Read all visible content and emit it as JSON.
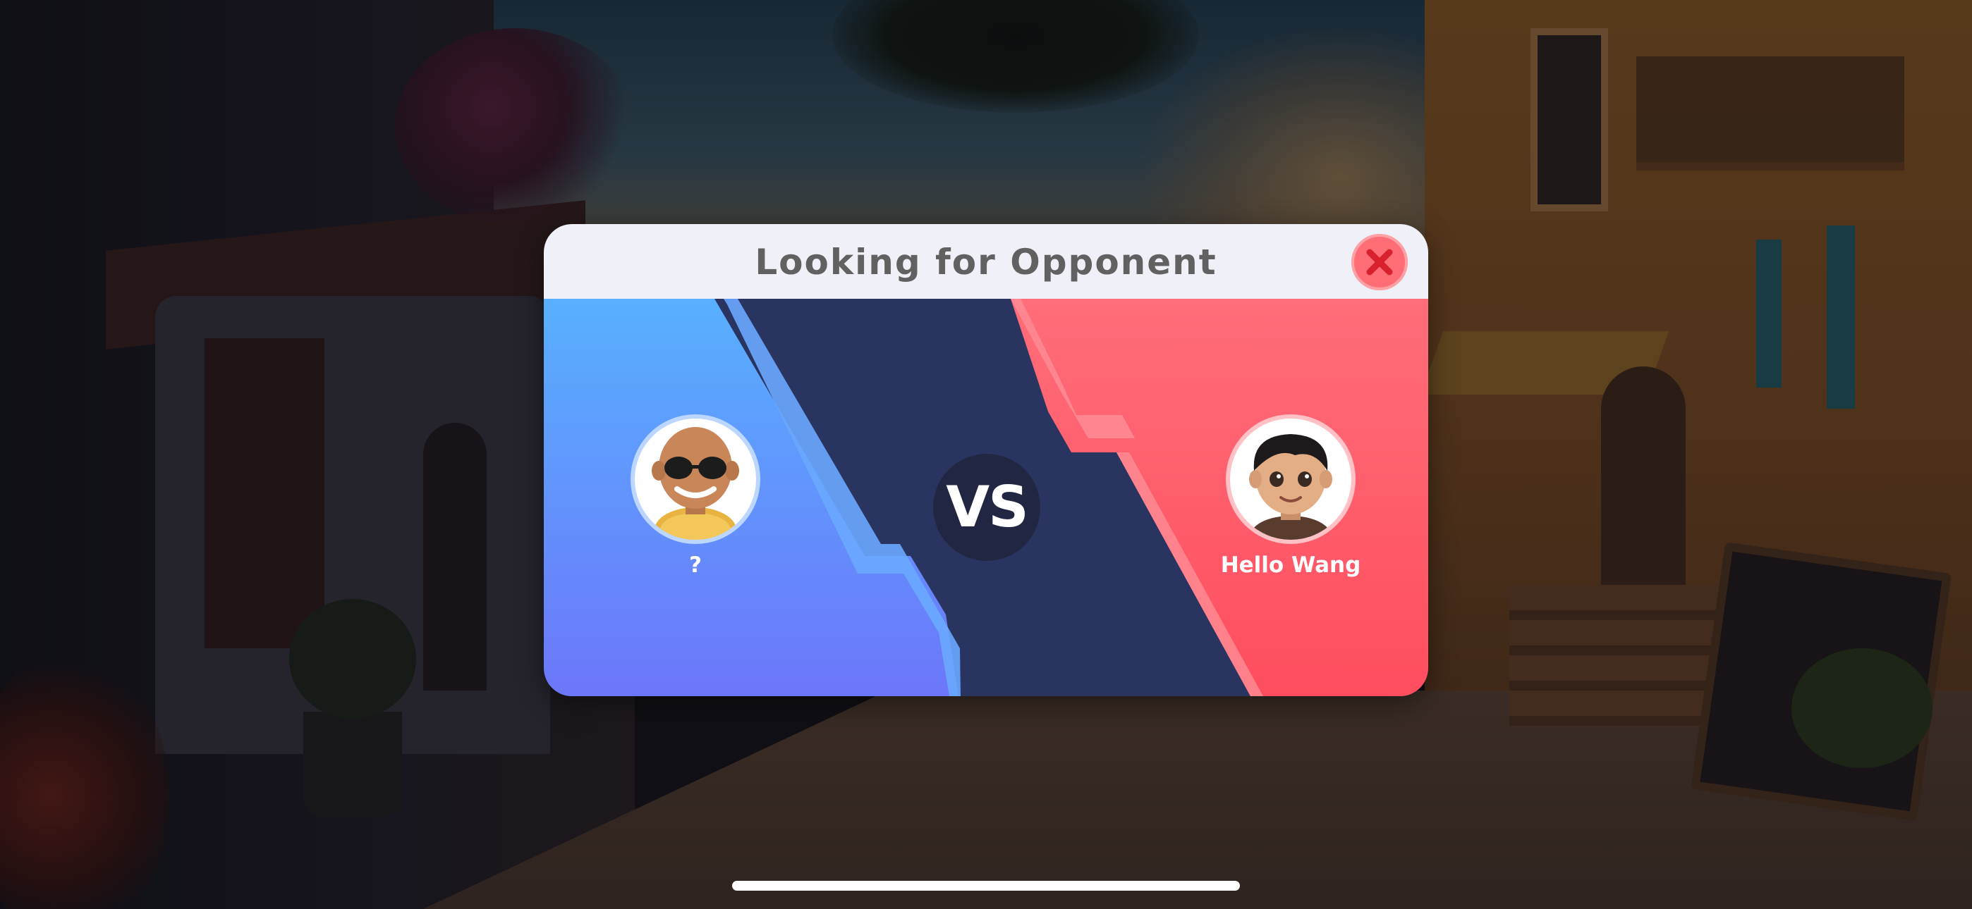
{
  "dialog": {
    "title": "Looking for Opponent",
    "close_icon": "close-icon"
  },
  "players": {
    "left": {
      "name": "?",
      "avatar": "avatar-sunglasses"
    },
    "right": {
      "name": "Hello Wang",
      "avatar": "avatar-boy"
    }
  },
  "versus": {
    "label": "VS"
  },
  "colors": {
    "header_bg": "#f0f0f8",
    "title_text": "#616161",
    "close_button": "#ff6d76",
    "left_panel_top": "#58b0ff",
    "left_panel_bottom": "#6c76fa",
    "center_panel": "#2a3460",
    "right_panel_top": "#ff6e7a",
    "right_panel_bottom": "#ff4d5e",
    "vs_circle": "#212742"
  }
}
